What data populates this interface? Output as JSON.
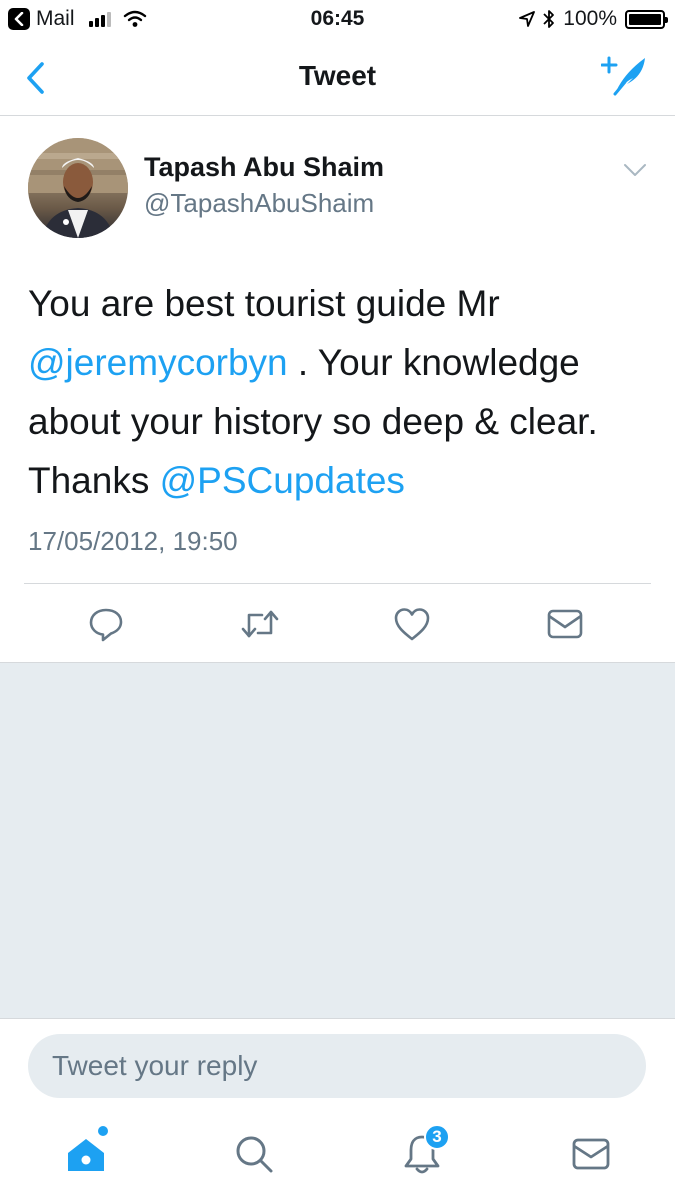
{
  "status_bar": {
    "back_app": "Mail",
    "time": "06:45",
    "battery": "100%"
  },
  "nav": {
    "title": "Tweet"
  },
  "tweet": {
    "display_name": "Tapash Abu Shaim",
    "handle": "@TapashAbuShaim",
    "text_part1": "You are best tourist guide Mr ",
    "mention1": "@jeremycorbyn",
    "text_part2": " . Your knowledge about your history so deep & clear. Thanks ",
    "mention2": "@PSCupdates",
    "timestamp": "17/05/2012, 19:50",
    "actions": [
      "reply-icon",
      "retweet-icon",
      "like-icon",
      "direct-message-icon"
    ]
  },
  "reply": {
    "placeholder": "Tweet your reply"
  },
  "tab_bar": {
    "tabs": [
      "home-icon",
      "search-icon",
      "notifications-icon",
      "messages-icon"
    ],
    "notifications_badge": "3"
  },
  "colors": {
    "accent": "#1da1f2",
    "secondary_text": "#657786",
    "background_gray": "#e6ecf0"
  }
}
